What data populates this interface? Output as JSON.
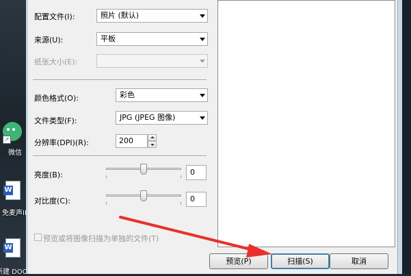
{
  "desktop": {
    "icons": [
      {
        "label": "微信",
        "icon": "wechat-icon"
      },
      {
        "label": "免麦声II",
        "icon": "word-doc-icon"
      },
      {
        "label": "新建 DOC",
        "icon": "word-doc-icon"
      }
    ]
  },
  "scan_dialog": {
    "profile": {
      "label": "配置文件(I):",
      "value": "照片 (默认)"
    },
    "source": {
      "label": "来源(U):",
      "value": "平板"
    },
    "paper_size": {
      "label": "纸张大小(E):",
      "value": ""
    },
    "color_format": {
      "label": "颜色格式(O):",
      "value": "彩色"
    },
    "file_type": {
      "label": "文件类型(F):",
      "value": "JPG (JPEG 图像)"
    },
    "resolution": {
      "label": "分辨率(DPI)(R):",
      "value": "200"
    },
    "brightness": {
      "label": "亮度(B):",
      "value": "0",
      "level": 0
    },
    "contrast": {
      "label": "对比度(C):",
      "value": "0",
      "level": 0
    },
    "separate_files": {
      "label": "预览或将图像扫描为单独的文件(T)",
      "checked": false
    },
    "buttons": {
      "preview": "预览(P)",
      "scan": "扫描(S)",
      "cancel": "取消"
    }
  },
  "annotation": {
    "arrow_color": "#e8312c"
  },
  "colors": {
    "window_bg": "#f0f0f0",
    "focus_border": "#3c7fb1"
  }
}
